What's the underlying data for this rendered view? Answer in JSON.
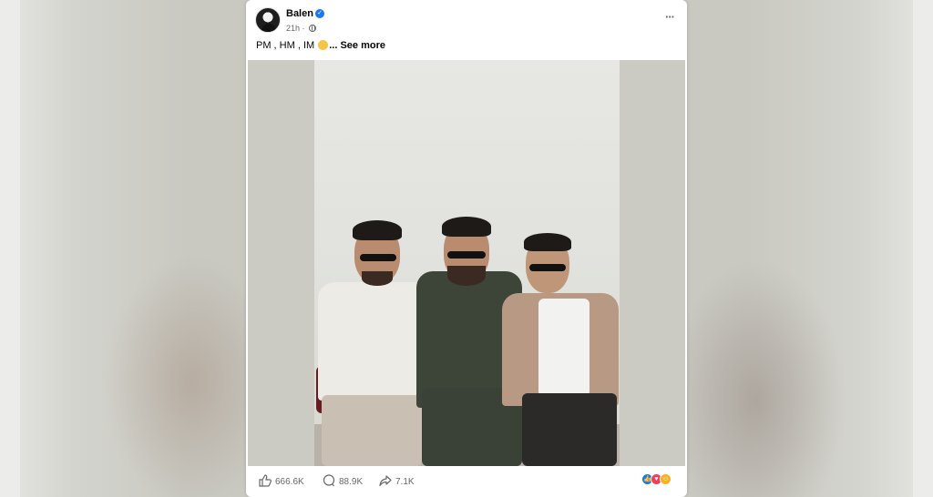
{
  "post": {
    "author": "Balen",
    "time": "21h ·",
    "caption_text": "PM , HM , IM",
    "caption_more": "... See more",
    "visibility_icon": "globe-icon",
    "menu_icon": "more-horizontal-icon"
  },
  "photo": {
    "subject_icon": "photo"
  },
  "footer": {
    "likes": "666.6K",
    "comments": "88.9K",
    "shares": "7.1K",
    "reactions": [
      "like",
      "love",
      "care"
    ]
  },
  "colors": {
    "brand": "#1877f2",
    "love": "#f33e58",
    "care": "#f7b125",
    "secondary_text": "#65676b"
  }
}
